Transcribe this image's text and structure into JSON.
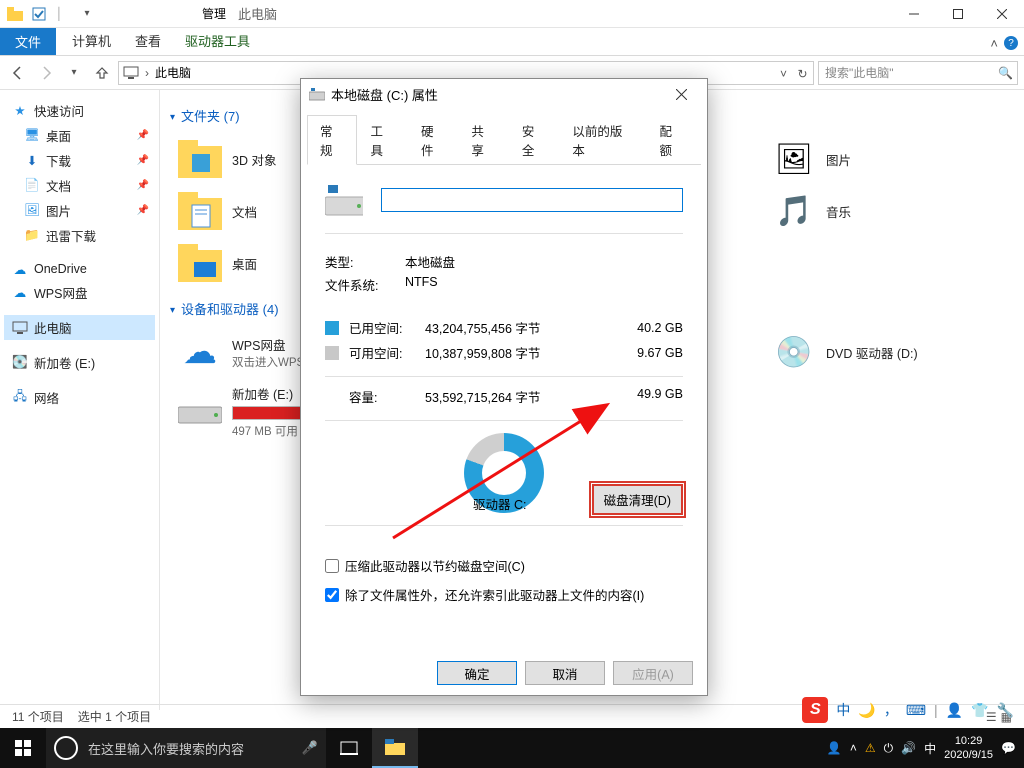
{
  "window": {
    "title": "此电脑",
    "contextTab": "管理",
    "ribbon": {
      "file": "文件",
      "tabs": [
        "计算机",
        "查看",
        "驱动器工具"
      ]
    },
    "winControls": {
      "min": "—",
      "max": "▢",
      "close": "✕"
    }
  },
  "nav": {
    "path": "此电脑",
    "searchPlaceholder": "搜索\"此电脑\""
  },
  "sidebar": {
    "groups": [
      {
        "icon": "star",
        "label": "快速访问"
      },
      {
        "icon": "desktop",
        "label": "桌面",
        "pinned": true
      },
      {
        "icon": "download",
        "label": "下载",
        "pinned": true
      },
      {
        "icon": "document",
        "label": "文档",
        "pinned": true
      },
      {
        "icon": "picture",
        "label": "图片",
        "pinned": true
      },
      {
        "icon": "folder",
        "label": "迅雷下载"
      }
    ],
    "cloud": [
      {
        "icon": "onedrive",
        "label": "OneDrive"
      },
      {
        "icon": "wps",
        "label": "WPS网盘"
      }
    ],
    "thispc": {
      "label": "此电脑"
    },
    "volume": {
      "label": "新加卷 (E:)"
    },
    "network": {
      "label": "网络"
    }
  },
  "content": {
    "folderGroup": {
      "title": "文件夹 (7)",
      "items": [
        {
          "label": "3D 对象"
        },
        {
          "label": "文档"
        },
        {
          "label": "桌面"
        },
        {
          "label": "图片"
        },
        {
          "label": "音乐"
        }
      ]
    },
    "deviceGroup": {
      "title": "设备和驱动器 (4)",
      "wps": {
        "label": "WPS网盘",
        "sub": "双击进入WPS"
      },
      "driveE": {
        "label": "新加卷 (E:)",
        "sub": "497 MB 可用"
      },
      "dvd": {
        "label": "DVD 驱动器 (D:)"
      }
    }
  },
  "status": {
    "count": "11 个项目",
    "selected": "选中 1 个项目"
  },
  "dialog": {
    "title": "本地磁盘 (C:) 属性",
    "tabs": [
      "常规",
      "工具",
      "硬件",
      "共享",
      "安全",
      "以前的版本",
      "配额"
    ],
    "driveName": "",
    "typeLabel": "类型:",
    "typeValue": "本地磁盘",
    "fsLabel": "文件系统:",
    "fsValue": "NTFS",
    "usedLabel": "已用空间:",
    "usedBytes": "43,204,755,456 字节",
    "usedGB": "40.2 GB",
    "freeLabel": "可用空间:",
    "freeBytes": "10,387,959,808 字节",
    "freeGB": "9.67 GB",
    "capLabel": "容量:",
    "capBytes": "53,592,715,264 字节",
    "capGB": "49.9 GB",
    "driveLetter": "驱动器 C:",
    "cleanup": "磁盘清理(D)",
    "chkCompress": "压缩此驱动器以节约磁盘空间(C)",
    "chkIndex": "除了文件属性外，还允许索引此驱动器上文件的内容(I)",
    "ok": "确定",
    "cancel": "取消",
    "apply": "应用(A)"
  },
  "taskbar": {
    "search": "在这里输入你要搜索的内容",
    "time": "10:29",
    "date": "2020/9/15",
    "imeText": "中"
  },
  "imebar": {
    "lang": "中"
  }
}
